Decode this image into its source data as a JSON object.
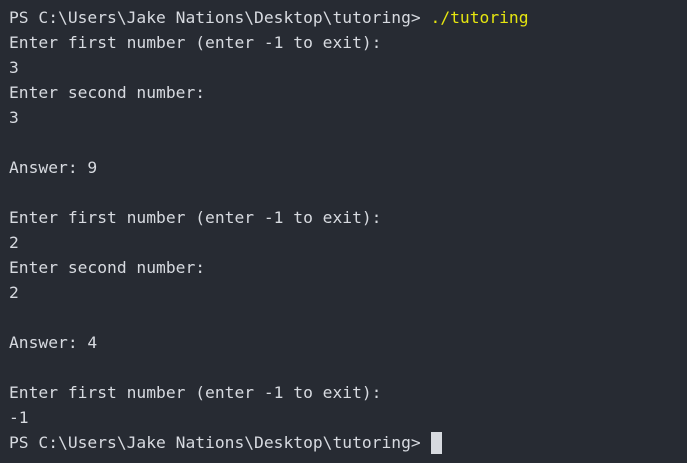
{
  "terminal": {
    "prompt": "PS C:\\Users\\Jake Nations\\Desktop\\tutoring>",
    "command": "./tutoring",
    "lines": [
      "Enter first number (enter -1 to exit):",
      "3",
      "Enter second number:",
      "3",
      "",
      "Answer: 9",
      "",
      "Enter first number (enter -1 to exit):",
      "2",
      "Enter second number:",
      "2",
      "",
      "Answer: 4",
      "",
      "Enter first number (enter -1 to exit):",
      "-1"
    ],
    "final_prompt": "PS C:\\Users\\Jake Nations\\Desktop\\tutoring>"
  },
  "colors": {
    "background": "#272b33",
    "text": "#d7dae0",
    "command": "#e5e510"
  }
}
